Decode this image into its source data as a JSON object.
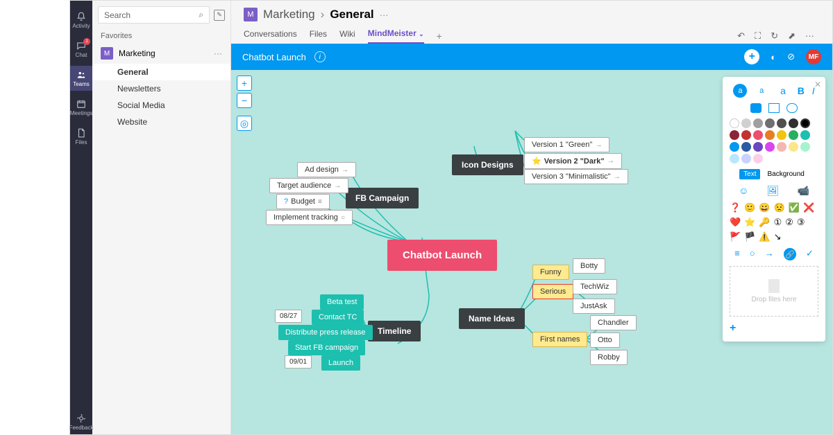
{
  "rail": {
    "items": [
      {
        "label": "Activity",
        "icon": "bell"
      },
      {
        "label": "Chat",
        "icon": "chat",
        "badge": "1"
      },
      {
        "label": "Teams",
        "icon": "teams",
        "active": true
      },
      {
        "label": "Meetings",
        "icon": "calendar"
      },
      {
        "label": "Files",
        "icon": "file"
      }
    ],
    "bottom": {
      "label": "Feedback"
    }
  },
  "sidebar": {
    "search_placeholder": "Search",
    "favorites_label": "Favorites",
    "team_letter": "M",
    "team_name": "Marketing",
    "channels": [
      "General",
      "Newsletters",
      "Social Media",
      "Website"
    ]
  },
  "header": {
    "team_letter": "M",
    "team_name": "Marketing",
    "channel_name": "General",
    "tabs": [
      "Conversations",
      "Files",
      "Wiki",
      "MindMeister"
    ],
    "active_tab": "MindMeister"
  },
  "mindmeister_bar": {
    "title": "Chatbot Launch",
    "avatar": "MF"
  },
  "mindmap": {
    "central": "Chatbot Launch",
    "fb_campaign": {
      "title": "FB Campaign",
      "children": [
        "Ad design",
        "Target audience",
        "Budget",
        "Implement tracking"
      ]
    },
    "icon_designs": {
      "title": "Icon Designs",
      "children": [
        "Version 1 \"Green\"",
        "Version 2 \"Dark\"",
        "Version 3 \"Minimalistic\""
      ]
    },
    "timeline": {
      "title": "Timeline",
      "children": [
        "Beta test",
        "Contact TC",
        "Distribute press release",
        "Start FB campaign",
        "Launch"
      ],
      "dates": [
        "08/27",
        "09/01"
      ]
    },
    "name_ideas": {
      "title": "Name Ideas",
      "funny": {
        "label": "Funny",
        "items": [
          "Botty",
          "TechWiz",
          "JustAsk"
        ]
      },
      "serious": {
        "label": "Serious"
      },
      "first_names": {
        "label": "First names",
        "items": [
          "Chandler",
          "Otto",
          "Robby"
        ]
      }
    }
  },
  "panel": {
    "text_label": "Text",
    "background_label": "Background",
    "drop_label": "Drop files here",
    "colors": [
      "#ffffff",
      "#d0d0d0",
      "#a0a0a0",
      "#707070",
      "#505050",
      "#303030",
      "#000000",
      "#8b2635",
      "#c53030",
      "#ed4d6e",
      "#e67e22",
      "#f1c40f",
      "#27ae60",
      "#1dbfaf",
      "#0098f0",
      "#2c5aa0",
      "#6b46c1",
      "#d946ef",
      "#f5b7b1",
      "#fde68a",
      "#a7f3d0",
      "#bae6fd",
      "#c7d2fe",
      "#fbcfe8"
    ],
    "emojis": [
      "❓",
      "🙂",
      "😀",
      "😟",
      "✅",
      "❌",
      "❤️",
      "⭐",
      "🔑",
      "①",
      "②",
      "③",
      "🚩",
      "🏴",
      "⚠️",
      "↘"
    ]
  }
}
